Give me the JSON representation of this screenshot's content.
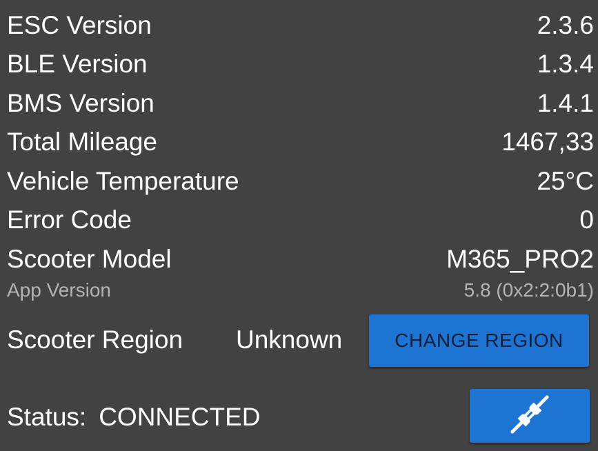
{
  "info_rows": [
    {
      "label": "ESC Version",
      "value": "2.3.6"
    },
    {
      "label": "BLE Version",
      "value": "1.3.4"
    },
    {
      "label": "BMS Version",
      "value": "1.4.1"
    },
    {
      "label": "Total Mileage",
      "value": "1467,33"
    },
    {
      "label": "Vehicle Temperature",
      "value": "25°C"
    },
    {
      "label": "Error Code",
      "value": "0"
    },
    {
      "label": "Scooter Model",
      "value": "M365_PRO2"
    }
  ],
  "app_version": {
    "label": "App Version",
    "value": "5.8 (0x2:2:0b1)"
  },
  "region": {
    "label": "Scooter Region",
    "value": "Unknown",
    "button_label": "CHANGE REGION"
  },
  "status": {
    "label": "Status:",
    "value": "CONNECTED"
  },
  "disconnect_button": {
    "icon": "plug-disconnect-icon"
  },
  "colors": {
    "background": "#424242",
    "accent": "#1e74d2",
    "primary_text": "#ffffff",
    "secondary_text": "#b4b4b4"
  }
}
